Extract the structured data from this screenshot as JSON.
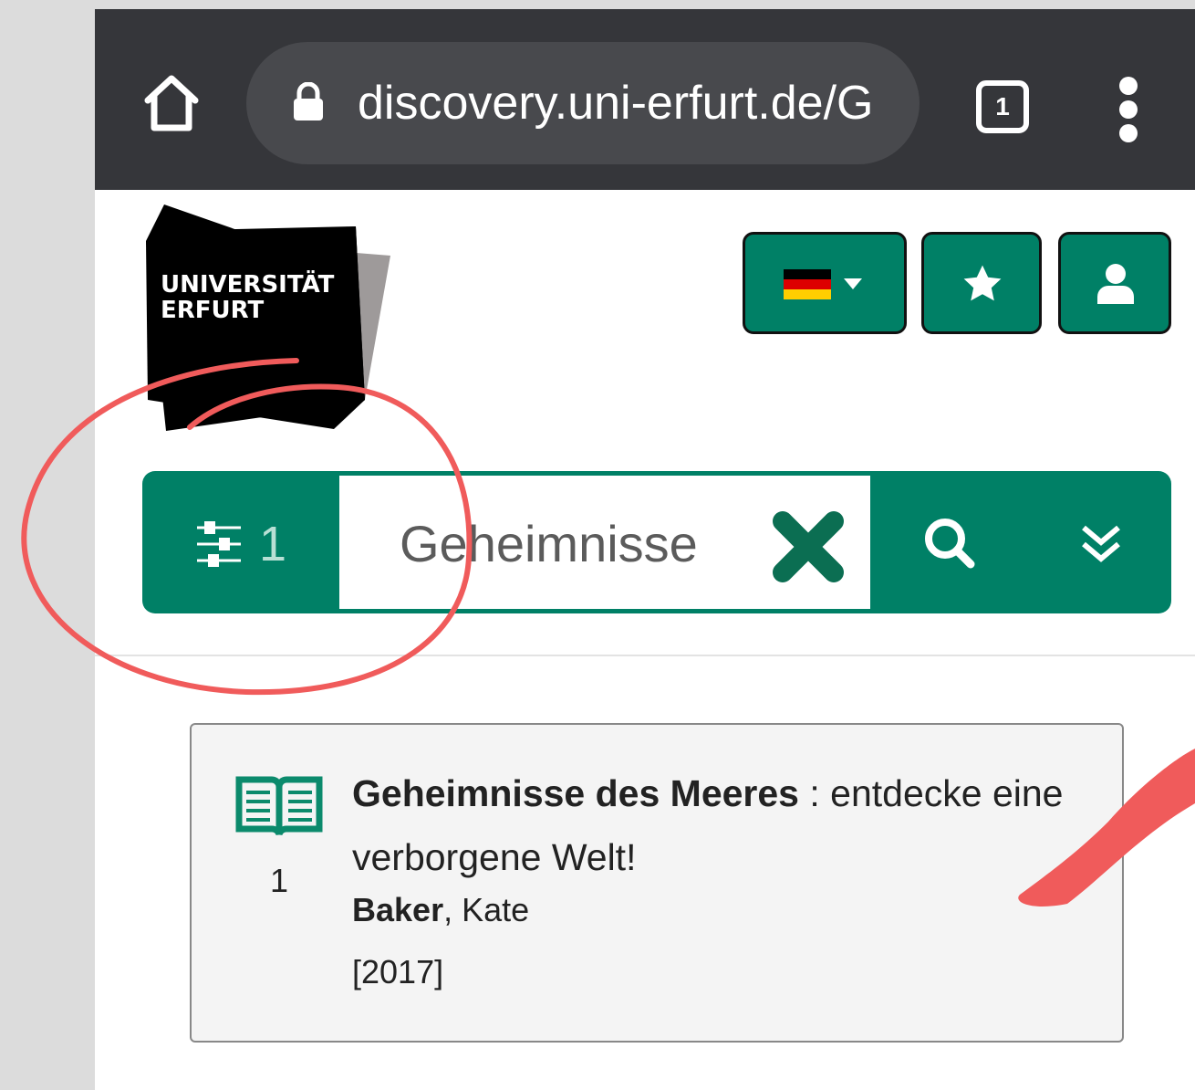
{
  "browser": {
    "url": "discovery.uni-erfurt.de/G",
    "tab_count": "1",
    "icons": {
      "home": "home-icon",
      "lock": "lock-icon",
      "menu": "kebab-menu-icon"
    }
  },
  "header": {
    "logo_line1": "UNIVERSITÄT",
    "logo_line2": "ERFURT",
    "buttons": [
      "language-flag-de",
      "favorites-star",
      "user-account"
    ]
  },
  "search": {
    "filter_count": "1",
    "query": "Geheimnisse"
  },
  "results": [
    {
      "number": "1",
      "title_bold": "Geheimnisse des Meeres",
      "title_rest": " : entdecke eine verborgene Welt!",
      "author_last": "Baker",
      "author_first": ", Kate",
      "year": "[2017]",
      "type_icon": "book-icon"
    }
  ],
  "colors": {
    "brand_green": "#008066",
    "chrome_dark": "#35363a",
    "annotation_red": "#f05b5b"
  }
}
